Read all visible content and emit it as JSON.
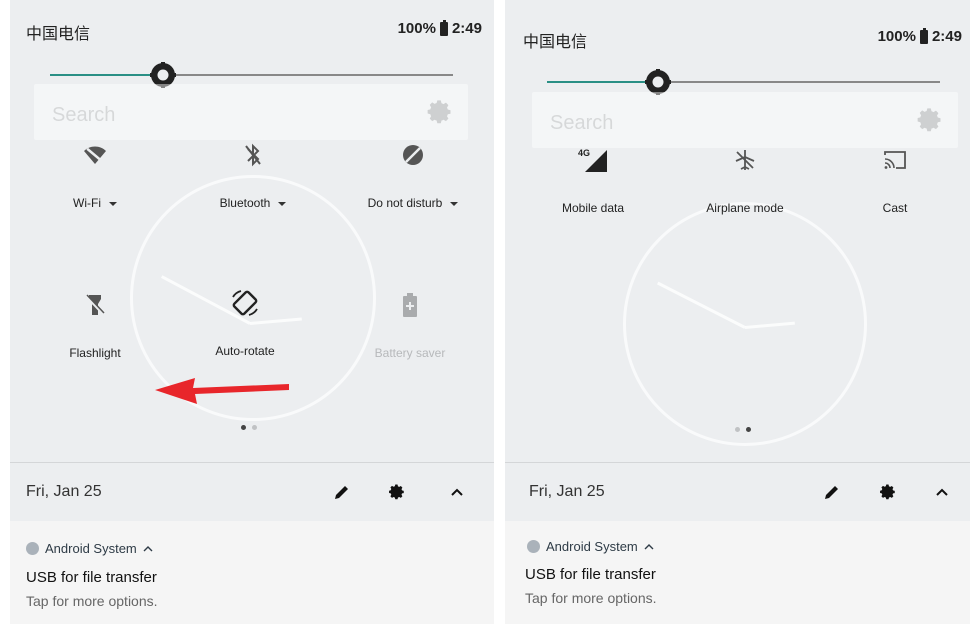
{
  "status": {
    "carrier": "中国电信",
    "battery": "100%",
    "time": "2:49"
  },
  "search": {
    "placeholder": "Search"
  },
  "panel1": {
    "brightness": 0.29,
    "tiles": [
      {
        "label": "Wi-Fi",
        "icon": "wifi-off-icon",
        "dropdown": true
      },
      {
        "label": "Bluetooth",
        "icon": "bluetooth-off-icon",
        "dropdown": true
      },
      {
        "label": "Do not disturb",
        "icon": "do-not-disturb-icon",
        "dropdown": true
      },
      {
        "label": "Flashlight",
        "icon": "flashlight-off-icon"
      },
      {
        "label": "Auto-rotate",
        "icon": "auto-rotate-icon"
      },
      {
        "label": "Battery saver",
        "icon": "battery-saver-icon"
      }
    ],
    "page_indicator": {
      "pages": 2,
      "current": 1
    }
  },
  "panel2": {
    "brightness": 0.28,
    "tiles": [
      {
        "label": "Mobile data",
        "icon": "mobile-data-4g-icon"
      },
      {
        "label": "Airplane mode",
        "icon": "airplane-mode-icon"
      },
      {
        "label": "Cast",
        "icon": "cast-icon"
      }
    ],
    "page_indicator": {
      "pages": 2,
      "current": 2
    }
  },
  "footer": {
    "date": "Fri, Jan 25"
  },
  "notification": {
    "app": "Android System",
    "title": "USB for file transfer",
    "text": "Tap for more options."
  },
  "colors": {
    "accent": "#2a8f85",
    "annotation_arrow": "#e8262b"
  }
}
